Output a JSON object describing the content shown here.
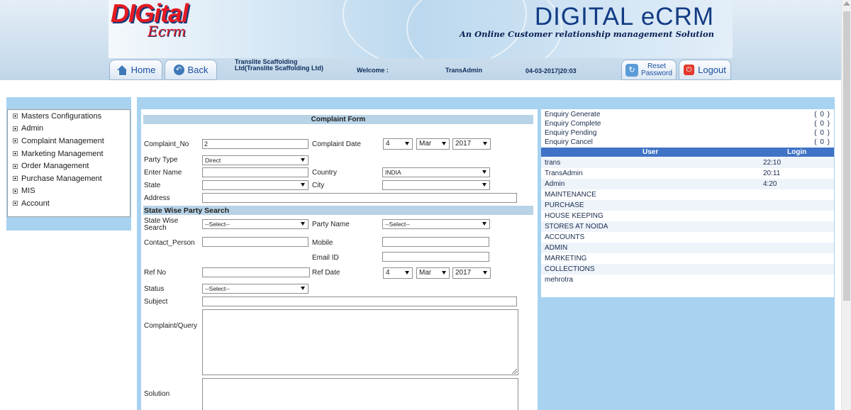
{
  "header": {
    "logo_left_main": "DIGital",
    "logo_left_sub": "Ecrm",
    "brand_title": "DIGITAL eCRM",
    "brand_subtitle": "An Online Customer relationship management Solution",
    "home_label": "Home",
    "back_label": "Back",
    "company": "Translite Scaffolding Ltd(Translite Scaffolding Ltd)",
    "welcome_label": "Welcome :",
    "username": "TransAdmin",
    "datetime": "04-03-2017|20:03",
    "reset_label": "Reset Password",
    "logout_label": "Logout",
    "icons": {
      "home": "home-icon",
      "back": "back-arrow-icon",
      "reset": "reset-password-icon",
      "logout": "logout-icon"
    }
  },
  "sidebar": {
    "items": [
      {
        "label": "Masters Configurations"
      },
      {
        "label": "Admin"
      },
      {
        "label": "Complaint Management"
      },
      {
        "label": "Marketing Management"
      },
      {
        "label": "Order Management"
      },
      {
        "label": "Purchase Management"
      },
      {
        "label": "MIS"
      },
      {
        "label": "Account"
      }
    ]
  },
  "form": {
    "title": "Complaint Form",
    "complaint_no_label": "Complaint_No",
    "complaint_no_value": "2",
    "complaint_date_label": "Complaint Date",
    "complaint_date": {
      "day": "4",
      "month": "Mar",
      "year": "2017"
    },
    "party_type_label": "Party Type",
    "party_type_value": "Direct",
    "enter_name_label": "Enter Name",
    "enter_name_value": "",
    "country_label": "Country",
    "country_value": "INDIA",
    "state_label": "State",
    "state_value": "",
    "city_label": "City",
    "city_value": "",
    "address_label": "Address",
    "address_value": "",
    "party_search_title": "State Wise Party Search",
    "state_wise_search_label": "State Wise Search",
    "state_wise_search_value": "--Select--",
    "party_name_label": "Party Name",
    "party_name_value": "--Select--",
    "contact_person_label": "Contact_Person",
    "contact_person_value": "",
    "mobile_label": "Mobile",
    "mobile_value": "",
    "email_label": "Email ID",
    "email_value": "",
    "ref_no_label": "Ref No",
    "ref_no_value": "",
    "ref_date_label": "Ref Date",
    "ref_date": {
      "day": "4",
      "month": "Mar",
      "year": "2017"
    },
    "status_label": "Status",
    "status_value": "--Select--",
    "subject_label": "Subject",
    "subject_value": "",
    "complaint_query_label": "Complaint/Query",
    "solution_label": "Solution"
  },
  "enquiries": [
    {
      "label": "Enquiry Generate",
      "count": "( 0 )"
    },
    {
      "label": "Enquiry Complete",
      "count": "( 0 )"
    },
    {
      "label": "Enquiry Pending",
      "count": "( 0 )"
    },
    {
      "label": "Enquiry Cancel",
      "count": "( 0 )"
    }
  ],
  "users_table": {
    "col_user": "User",
    "col_login": "Login",
    "rows": [
      {
        "user": "trans",
        "login": "22:10"
      },
      {
        "user": "TransAdmin",
        "login": "20:11"
      },
      {
        "user": "Admin",
        "login": "4:20"
      },
      {
        "user": "MAINTENANCE",
        "login": ""
      },
      {
        "user": "PURCHASE",
        "login": ""
      },
      {
        "user": "HOUSE KEEPING",
        "login": ""
      },
      {
        "user": "STORES AT NOIDA",
        "login": ""
      },
      {
        "user": "ACCOUNTS",
        "login": ""
      },
      {
        "user": "ADMIN",
        "login": ""
      },
      {
        "user": "MARKETING",
        "login": ""
      },
      {
        "user": "COLLECTIONS",
        "login": ""
      },
      {
        "user": "mehrotra",
        "login": ""
      }
    ]
  }
}
